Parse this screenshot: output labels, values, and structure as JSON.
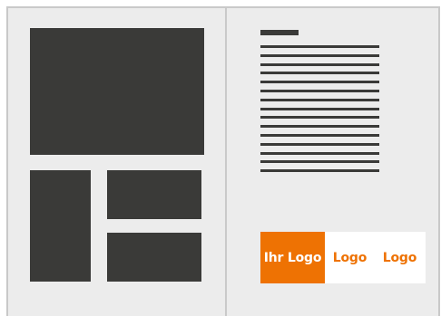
{
  "logos": {
    "primary": "Ihr Logo",
    "second": "Logo",
    "third": "Logo"
  },
  "colors": {
    "accent": "#ee7203",
    "block": "#3a3a38",
    "page": "#ececec",
    "border": "#c9c9c9"
  }
}
